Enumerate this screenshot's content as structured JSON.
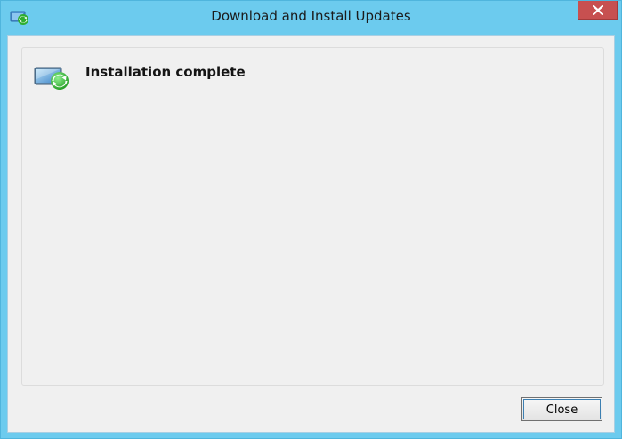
{
  "window": {
    "title": "Download and Install Updates"
  },
  "main": {
    "status_text": "Installation complete"
  },
  "footer": {
    "close_label": "Close"
  },
  "icons": {
    "title": "windows-update-icon",
    "status": "windows-update-icon",
    "window_close": "close-icon"
  },
  "colors": {
    "frame": "#6ccbee",
    "close_x_bg": "#c75050",
    "client_bg": "#f0f0f0",
    "update_green": "#33b233",
    "button_focus": "#3c7fb1"
  }
}
